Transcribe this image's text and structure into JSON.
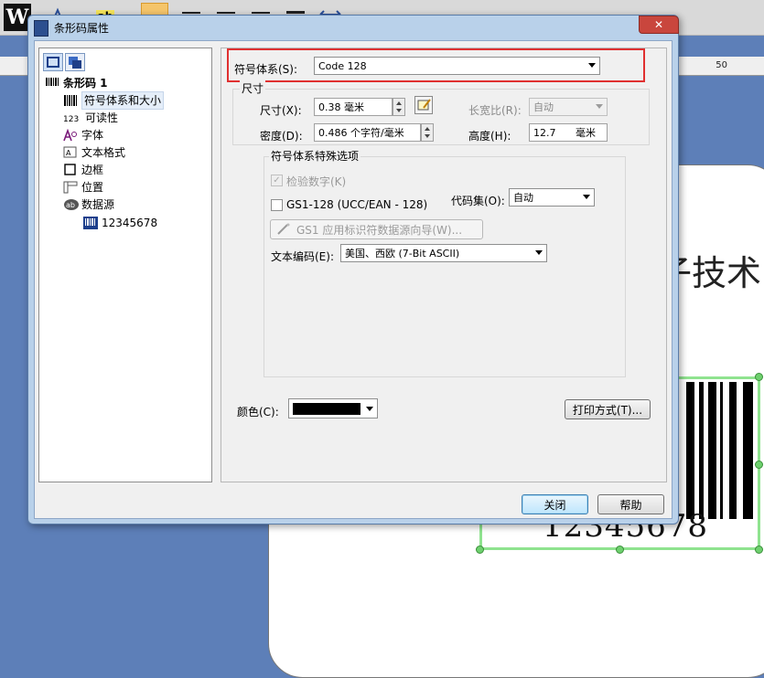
{
  "background": {
    "logo_letter": "W",
    "toolbar_ab": "ab",
    "ruler_value": "50",
    "canvas_text": "子技术",
    "barcode_text": "12345678"
  },
  "dialog": {
    "title": "条形码属性",
    "close_label": "✕",
    "tree": {
      "root": "条形码 1",
      "items": [
        {
          "label": "符号体系和大小"
        },
        {
          "label": "可读性",
          "prefix": "123"
        },
        {
          "label": "字体"
        },
        {
          "label": "文本格式"
        },
        {
          "label": "边框"
        },
        {
          "label": "位置"
        },
        {
          "label": "数据源"
        }
      ],
      "datasource_child": "12345678"
    },
    "symbology": {
      "label": "符号体系(S):",
      "value": "Code 128"
    },
    "size_group": {
      "title": "尺寸",
      "size_label": "尺寸(X):",
      "size_value": "0.38 毫米",
      "ratio_label": "长宽比(R):",
      "ratio_value": "自动",
      "density_label": "密度(D):",
      "density_value": "0.486 个字符/毫米",
      "height_label": "高度(H):",
      "height_value": "12.7",
      "height_unit": "毫米"
    },
    "special": {
      "title": "符号体系特殊选项",
      "check_digit_label": "检验数字(K)",
      "gs1_label": "GS1-128 (UCC/EAN - 128)",
      "codeset_label": "代码集(O):",
      "codeset_value": "自动",
      "gs1_wizard_label": "GS1 应用标识符数据源向导(W)...",
      "encoding_label": "文本编码(E):",
      "encoding_value": "美国、西欧 (7-Bit ASCII)"
    },
    "color": {
      "label": "颜色(C):",
      "value": "#000000"
    },
    "print_method_label": "打印方式(T)...",
    "close_button": "关闭",
    "help_button": "帮助"
  }
}
